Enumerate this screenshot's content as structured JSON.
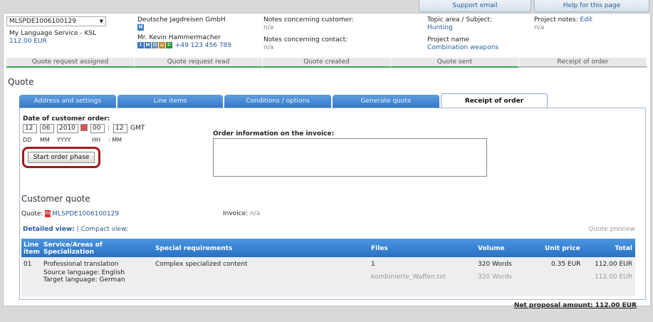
{
  "top_buttons": {
    "support": "Support email",
    "help": "Help for this page"
  },
  "header": {
    "project_id": "MLSPDE1006100129",
    "company": "My Language Service - KSL",
    "amount": "112.00 EUR",
    "customer_name": "Deutsche Jagdreisen GmbH",
    "customer_badge": "H",
    "contact_name": "Mr. Kevin Hammermacher",
    "phone": "+49 123 456 789",
    "notes_customer_label": "Notes concerning customer:",
    "notes_customer_value": "n/a",
    "notes_contact_label": "Notes concerning contact:",
    "notes_contact_value": "n/a",
    "topic_label": "Topic area / Subject:",
    "topic_value": "Hunting",
    "project_name_label": "Project name",
    "project_name_value": "Combination weapons",
    "project_notes_label": "Project notes:",
    "project_notes_edit": "Edit",
    "project_notes_value": "n/a"
  },
  "progress": [
    "Quote request assigned",
    "Quote request read",
    "Quote created",
    "Quote sent",
    "Receipt of order"
  ],
  "page_title": "Quote",
  "tabs": [
    "Address and settings",
    "Line items",
    "Conditions / options",
    "Generate quote",
    "Receipt of order"
  ],
  "order": {
    "date_label": "Date of customer order:",
    "day": "12",
    "month": "06",
    "year": "2010",
    "hour": "00",
    "minute": "12",
    "tz": "GMT",
    "dd": "DD",
    "mm": "MM",
    "yyyy": "YYYY",
    "hh": "HH",
    "mm2": ": MM",
    "colon": ":",
    "start_button": "Start order phase",
    "invoice_info_label": "Order information on the invoice:"
  },
  "customer_quote": {
    "title": "Customer quote",
    "quote_label": "Quote:",
    "quote_file": "MLSPDE1006100129",
    "invoice_label": "Invoice:",
    "invoice_value": "n/a",
    "detailed_view": "Detailed view:",
    "separator": "|",
    "compact_view": "Compact view:",
    "preview": "Quote preview"
  },
  "table": {
    "headers": {
      "line_item": "Line item",
      "service": "Service/Areas of Specialization",
      "special": "Special requirements",
      "files": "Files",
      "volume": "Volume",
      "unit_price": "Unit price",
      "total": "Total"
    },
    "row": {
      "line": "01",
      "service": "Professional translation",
      "source": "Source language: English",
      "target": "Target language:  German",
      "special": "Complex specialized content",
      "files_count": "1",
      "file_name": "kombinierte_Waffen.txt",
      "volume": "320 Words",
      "volume2": "320 Words",
      "unit_price": "0.35 EUR",
      "total": "112.00 EUR",
      "total2": "112.00 EUR"
    },
    "net_amount": "Net proposal amount: 112.00 EUR"
  }
}
